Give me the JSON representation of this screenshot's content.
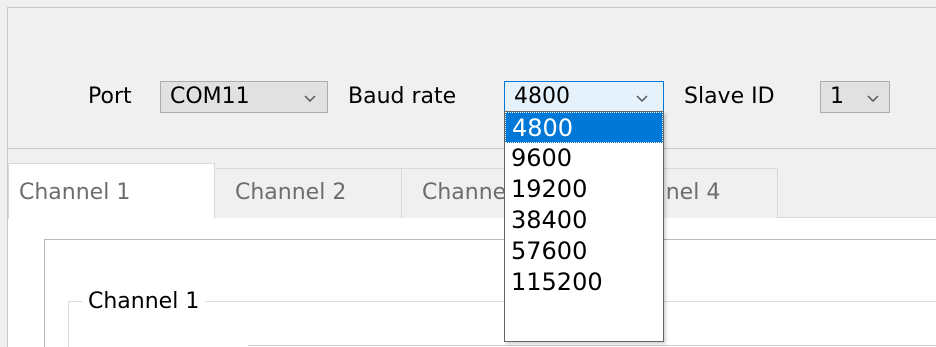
{
  "toolbar": {
    "port_label": "Port",
    "port_value": "COM11",
    "baud_label": "Baud rate",
    "baud_value": "4800",
    "slave_label": "Slave ID",
    "slave_value": "1"
  },
  "baud_dropdown": {
    "options": [
      "4800",
      "9600",
      "19200",
      "38400",
      "57600",
      "115200"
    ],
    "selected": "4800"
  },
  "tabs": [
    {
      "label": "Channel 1",
      "active": true
    },
    {
      "label": "Channel 2",
      "active": false
    },
    {
      "label": "Channel 3",
      "active": false
    },
    {
      "label": "Channel 4",
      "active": false
    }
  ],
  "tab_content": {
    "group_title": "Channel 1"
  },
  "icons": {
    "chevron": "chevron-down-icon"
  },
  "colors": {
    "selection": "#0078d7",
    "window_bg": "#f0f0f0"
  }
}
